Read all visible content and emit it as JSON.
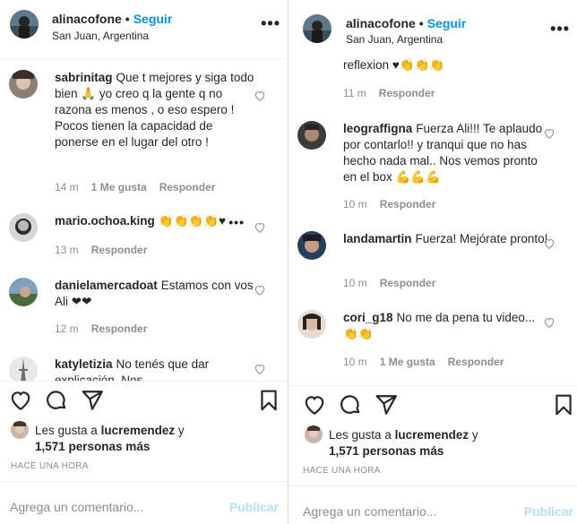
{
  "post": {
    "username": "alinacofone",
    "separator": "•",
    "follow_label": "Seguir",
    "location": "San Juan, Argentina",
    "more_label": "•••"
  },
  "left_comments": [
    {
      "user": "sabrinitag",
      "text": "Que t mejores y siga todo bien 🙏 yo creo q la gente q no razona es menos , o eso espero ! Pocos tienen la capacidad de ponerse en el lugar del otro !",
      "time": "14 m",
      "likes": "1 Me gusta",
      "reply": "Responder"
    },
    {
      "user": "mario.ochoa.king",
      "text": "👏👏👏👏♥",
      "time": "13 m",
      "likes": "",
      "reply": "Responder",
      "more": "•••"
    },
    {
      "user": "danielamercadoat",
      "text": "Estamos con vos Ali ❤❤",
      "time": "12 m",
      "likes": "",
      "reply": "Responder"
    },
    {
      "user": "katyletizia",
      "text": "No tenés que dar explicación. Nos",
      "time": "",
      "likes": "",
      "reply": ""
    }
  ],
  "right_comments": [
    {
      "user": "",
      "text": "reflexion ♥👏👏👏",
      "time": "11 m",
      "likes": "",
      "reply": "Responder"
    },
    {
      "user": "leograffigna",
      "text": "Fuerza Ali!!! Te aplaudo por contarlo!! y tranqui que no has hecho nada mal.. Nos vemos pronto en el box 💪💪💪",
      "time": "10 m",
      "likes": "",
      "reply": "Responder"
    },
    {
      "user": "landamartin",
      "text": "Fuerza! Mejórate pronto!",
      "time": "10 m",
      "likes": "",
      "reply": "Responder"
    },
    {
      "user": "cori_g18",
      "text": "No me da pena tu video...👏👏",
      "time": "10 m",
      "likes": "1 Me gusta",
      "reply": "Responder"
    }
  ],
  "likes": {
    "prefix": "Les gusta a",
    "user": "lucremendez",
    "suffix": "y",
    "others": "1,571 personas más"
  },
  "time_ago": "HACE UNA HORA",
  "add_comment": {
    "placeholder": "Agrega un comentario...",
    "publish_label": "Publicar"
  },
  "icons": [
    "heart-icon",
    "comment-icon",
    "share-icon",
    "bookmark-icon",
    "more-icon"
  ],
  "colors": {
    "link_blue": "#0095f6",
    "muted": "#8e8e8e",
    "publish_disabled": "#b2dffc",
    "border": "#dbdbdb"
  }
}
